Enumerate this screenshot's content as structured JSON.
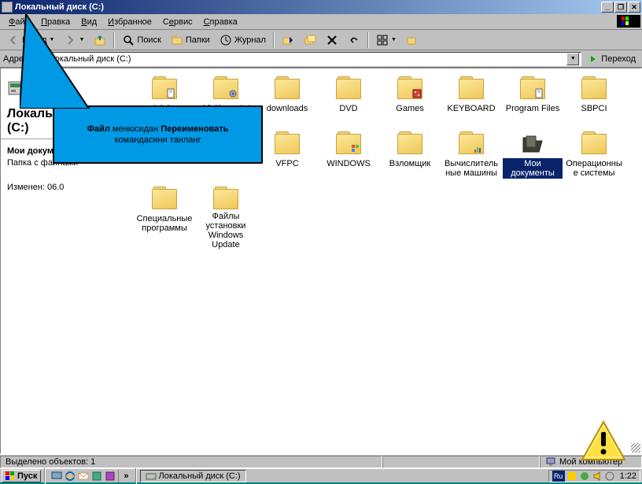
{
  "title": "Локальный диск (C:)",
  "menus": [
    "Файл",
    "Правка",
    "Вид",
    "Избранное",
    "Сервис",
    "Справка"
  ],
  "toolbar": {
    "back": "Назад",
    "search": "Поиск",
    "folders": "Папки",
    "history": "Журнал"
  },
  "address": {
    "label": "Адрес",
    "value": "Локальный диск (C:)",
    "go": "Переход"
  },
  "leftpanel": {
    "title": "Локальный диск (C:)",
    "item_name": "Мои документы",
    "item_desc": "Папка с файлами",
    "modified": "Изменен: 06.0"
  },
  "folders_row1": [
    {
      "name": "Adobe",
      "overlay": "doc"
    },
    {
      "name": "CDSlow v1.4",
      "overlay": "gear"
    },
    {
      "name": "downloads",
      "overlay": ""
    },
    {
      "name": "DVD",
      "overlay": ""
    },
    {
      "name": "Games",
      "overlay": "game"
    },
    {
      "name": "KEYBOARD",
      "overlay": ""
    },
    {
      "name": "Program Files",
      "overlay": "doc"
    },
    {
      "name": "SBPCI",
      "overlay": ""
    }
  ],
  "folders_row2": [
    {
      "name": "VFPC",
      "overlay": ""
    },
    {
      "name": "WINDOWS",
      "overlay": "win"
    },
    {
      "name": "Взломщик",
      "overlay": ""
    },
    {
      "name": "Вычислительные машины",
      "overlay": "chart"
    },
    {
      "name": "Мои документы",
      "overlay": "docs",
      "selected": true
    },
    {
      "name": "Операционные системы",
      "overlay": ""
    }
  ],
  "folders_row3": [
    {
      "name": "Специальные программы",
      "overlay": ""
    },
    {
      "name": "Файлы установки Windows Update",
      "overlay": ""
    }
  ],
  "statusbar": {
    "selected": "Выделено объектов: 1",
    "zone": "Мой компьютер"
  },
  "taskbar": {
    "start": "Пуск",
    "task1": "Локальный диск (C:)",
    "lang": "Ru",
    "clock": "1:22"
  },
  "callout": {
    "line1_b1": "Файл",
    "line1_t": " менюсидан ",
    "line1_b2": "Переименовать",
    "line2": "командасини танланг"
  }
}
